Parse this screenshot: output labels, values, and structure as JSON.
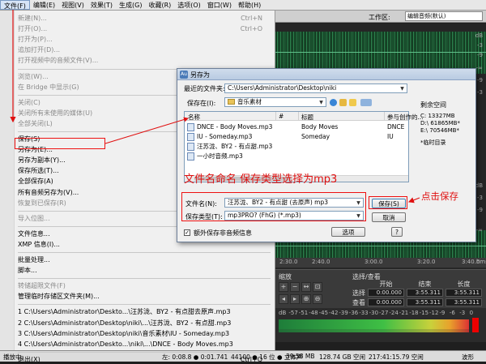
{
  "menubar": {
    "items": [
      "文件(F)",
      "编辑(E)",
      "视图(V)",
      "效果(T)",
      "生成(G)",
      "收藏(R)",
      "选项(O)",
      "窗口(W)",
      "帮助(H)"
    ]
  },
  "toolbar": {
    "workspace_label": "工作区:",
    "workspace_value": "编辑音频(默认)"
  },
  "file_menu": {
    "items": [
      {
        "label": "新建(N)...",
        "shortcut": "Ctrl+N",
        "disabled": true
      },
      {
        "label": "打开(O)...",
        "shortcut": "Ctrl+O",
        "disabled": true
      },
      {
        "label": "打开为(P)...",
        "shortcut": "",
        "disabled": true
      },
      {
        "label": "追加打开(D)...",
        "shortcut": "",
        "disabled": true
      },
      {
        "label": "打开视频中的音频文件(V)...",
        "shortcut": "",
        "disabled": true
      },
      {
        "label": "浏览(W)...",
        "shortcut": "",
        "disabled": true
      },
      {
        "label": "在 Bridge 中显示(G)",
        "shortcut": "",
        "disabled": true
      },
      {
        "label": "关闭(C)",
        "shortcut": "",
        "disabled": true
      },
      {
        "label": "关闭所有未使用的媒体(U)",
        "shortcut": "",
        "disabled": true
      },
      {
        "label": "全部关闭(L)",
        "shortcut": "",
        "disabled": true
      },
      {
        "label": "保存(S)",
        "shortcut": "",
        "disabled": false
      },
      {
        "label": "另存为(E)...",
        "shortcut": "",
        "disabled": false
      },
      {
        "label": "另存为副本(Y)...",
        "shortcut": "",
        "disabled": false
      },
      {
        "label": "保存所选(T)...",
        "shortcut": "",
        "disabled": false
      },
      {
        "label": "全部保存(A)",
        "shortcut": "",
        "disabled": false
      },
      {
        "label": "所有音频另存为(V)...",
        "shortcut": "",
        "disabled": false
      },
      {
        "label": "恢复到已保存(R)",
        "shortcut": "",
        "disabled": true
      },
      {
        "label": "导入位图...",
        "shortcut": "",
        "disabled": true
      },
      {
        "label": "文件信息...",
        "shortcut": "",
        "disabled": false
      },
      {
        "label": "XMP 信息(I)...",
        "shortcut": "",
        "disabled": false
      },
      {
        "label": "批量处理...",
        "shortcut": "",
        "disabled": false
      },
      {
        "label": "脚本...",
        "shortcut": "",
        "disabled": false
      },
      {
        "label": "转储超限文件(F)",
        "shortcut": "",
        "disabled": true
      },
      {
        "label": "管理临时存储区文件夹(M)...",
        "shortcut": "",
        "disabled": false
      },
      {
        "label": "1 C:\\Users\\Administrator\\Deskto...\\汪苏泷、BY2 - 有点甜去原声.mp3",
        "shortcut": "",
        "disabled": false
      },
      {
        "label": "2 C:\\Users\\Administrator\\Desktop\\niki\\...\\汪苏泷、BY2 - 有点甜.mp3",
        "shortcut": "",
        "disabled": false
      },
      {
        "label": "3 C:\\Users\\Administrator\\Desktop\\niki\\音乐素材\\IU - Someday.mp3",
        "shortcut": "",
        "disabled": false
      },
      {
        "label": "4 C:\\Users\\Administrator\\Deskto...\\niki\\...\\DNCE - Body Moves.mp3",
        "shortcut": "",
        "disabled": false
      },
      {
        "label": "退出(X)",
        "shortcut": "Ctrl+Q",
        "disabled": false
      }
    ]
  },
  "dialog": {
    "title": "另存为",
    "recent_label": "最近的文件夹:",
    "recent_value": "C:\\Users\\Administrator\\Desktop\\niki",
    "save_in_label": "保存在(I):",
    "save_in_value": "音乐素材",
    "columns": [
      "名称",
      "#",
      "标题",
      "参与创作的..."
    ],
    "files": [
      {
        "name": "DNCE - Body Moves.mp3",
        "title": "Body Moves",
        "artist": "DNCE"
      },
      {
        "name": "IU - Someday.mp3",
        "title": "Someday",
        "artist": "IU"
      },
      {
        "name": "汪苏泷、BY2 - 有点甜.mp3",
        "title": "",
        "artist": ""
      },
      {
        "name": "一小时音频.mp3",
        "title": "",
        "artist": ""
      }
    ],
    "free_space_title": "剩余空间",
    "drives": [
      "C:   13327MB",
      "D:\\  61865MB*",
      "E:\\  70546MB*"
    ],
    "temp_note": "*临时目录",
    "filename_label": "文件名(N):",
    "filename_value": "汪苏泷、BY2 - 有点甜 (去原声)  mp3",
    "filetype_label": "保存类型(T):",
    "filetype_value": "mp3PRO? (FhG) (*.mp3)",
    "save_button": "保存(S)",
    "cancel_button": "取消",
    "options_button": "选项",
    "extra_checkbox_label": "额外保存非音频信息",
    "extra_checkbox_mark": "✓"
  },
  "annotations": {
    "filename_note": "文件名命名 保存类型选择为mp3",
    "save_note": "点击保存"
  },
  "panels": {
    "zoom_title": "缩放",
    "sel_title": "选择/查看",
    "sel_cols": [
      "开始",
      "结束",
      "长度"
    ],
    "sel_rows": [
      {
        "label": "选择",
        "start": "0:00.000",
        "end": "3:55.311",
        "length": "3:55.311"
      },
      {
        "label": "查看",
        "start": "0:00.000",
        "end": "3:55.311",
        "length": "3:55.311"
      }
    ]
  },
  "ruler_labels": [
    "2:30.0",
    "2:40.0",
    "3:00.0",
    "3:20.0",
    "3:40.0",
    "hms"
  ],
  "db_labels": [
    "dB",
    "-3",
    "-9",
    "-∞",
    "-9",
    "-3",
    "dB",
    "-3",
    "-9",
    "-∞"
  ],
  "meter_labels": [
    "dB",
    "-57",
    "-51",
    "-48",
    "-45",
    "-42",
    "-39",
    "-36",
    "-33",
    "-30",
    "-27",
    "-24",
    "-21",
    "-18",
    "-15",
    "-12",
    "-9",
    "-6",
    "-3",
    "0"
  ],
  "statusbar": {
    "left": "播放中",
    "cells": [
      "左: 0:08.8 ● 0:01.741",
      "44100 ● 16 位 ● 立体声",
      "39.58 MB",
      "128.74 GB 空闲",
      "217:41:15.79 空闲",
      "波形"
    ]
  },
  "colors": {
    "annotation_red": "#e01010",
    "waveform_green": "#2e8b52"
  }
}
